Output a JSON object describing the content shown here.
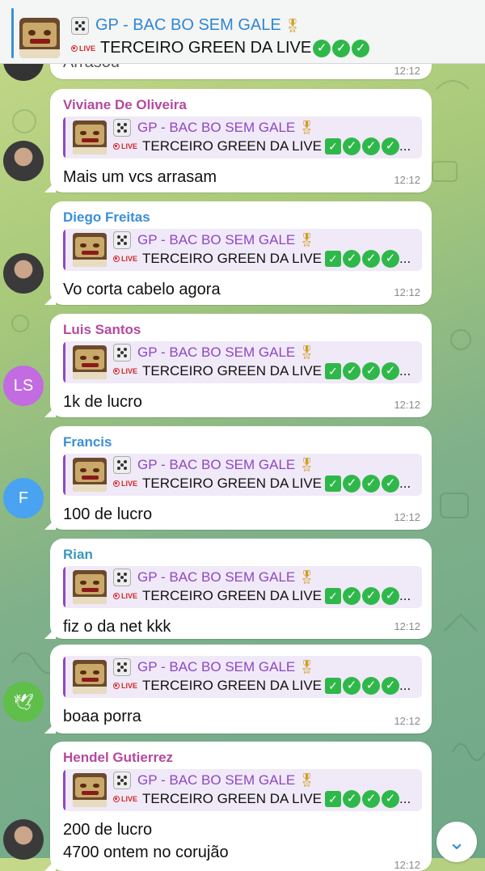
{
  "pinned": {
    "title": "GP - BAC BO SEM GALE",
    "live_label": "LIVE",
    "text": "TERCEIRO GREEN DA LIVE"
  },
  "reply_preview": {
    "title": "GP - BAC BO SEM GALE",
    "live_label": "LIVE",
    "text": "TERCEIRO GREEN DA LIVE",
    "ellipsis": "..."
  },
  "partial_top": {
    "text": "Arrasou",
    "time": "12:12"
  },
  "messages": [
    {
      "sender": "Viviane De Oliveira",
      "sender_color": "#b5499e",
      "text": "Mais um vcs arrasam",
      "time": "12:12",
      "avatar": "photo"
    },
    {
      "sender": "Diego Freitas",
      "sender_color": "#3a8fd6",
      "text": "Vo corta cabelo agora",
      "time": "12:12",
      "avatar": "photo"
    },
    {
      "sender": "Luis Santos",
      "sender_color": "#b5499e",
      "text": "1k de lucro",
      "time": "12:12",
      "avatar_initials": "LS",
      "avatar_color": "#c36be0"
    },
    {
      "sender": "Francis",
      "sender_color": "#3a8fd6",
      "text": "100 de lucro",
      "time": "12:12",
      "avatar_initials": "F",
      "avatar_color": "#4aa3f0"
    },
    {
      "sender": "Rian",
      "sender_color": "#3a9aba",
      "text": "fiz o da net kkk",
      "time": "12:12",
      "avatar": "none"
    },
    {
      "sender": "",
      "text": "boaa porra",
      "time": "12:12",
      "avatar": "dove"
    },
    {
      "sender": "Hendel Gutierrez",
      "sender_color": "#b5499e",
      "text": "200 de lucro",
      "text2": "4700 ontem no corujão",
      "time": "12:12",
      "avatar": "photo"
    }
  ],
  "colors": {
    "accent": "#3a8fd6",
    "reply_accent": "#8e47c4",
    "check_green": "#2fb84a"
  }
}
